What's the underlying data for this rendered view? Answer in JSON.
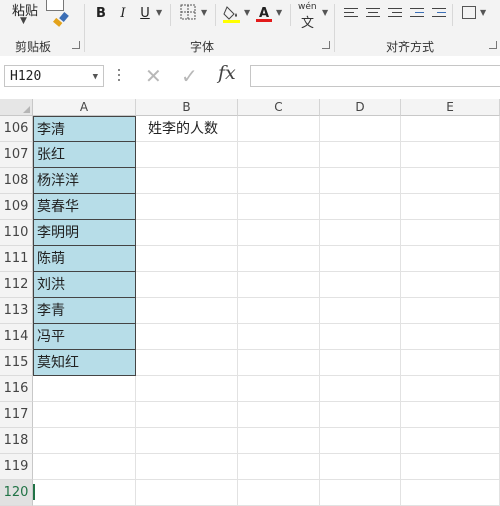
{
  "ribbon": {
    "paste_label": "粘贴",
    "clipboard_label": "剪贴板",
    "font_label": "字体",
    "alignment_label": "对齐方式",
    "bold": "B",
    "italic": "I",
    "underline": "U",
    "font_color_letter": "A",
    "phonetic_top": "wén",
    "phonetic_bottom": "文",
    "accent_red": "#e21a1a",
    "fill_yellow": "#ffff00"
  },
  "formula_bar": {
    "name_box": "H120",
    "fx": "fx",
    "cancel_icon": "cross-icon",
    "enter_icon": "check-icon",
    "value": ""
  },
  "grid": {
    "columns": [
      "A",
      "B",
      "C",
      "D",
      "E"
    ],
    "rows": [
      {
        "num": "106",
        "a": "李清",
        "b": "姓李的人数"
      },
      {
        "num": "107",
        "a": "张红",
        "b": ""
      },
      {
        "num": "108",
        "a": "杨洋洋",
        "b": ""
      },
      {
        "num": "109",
        "a": "莫春华",
        "b": ""
      },
      {
        "num": "110",
        "a": "李明明",
        "b": ""
      },
      {
        "num": "111",
        "a": "陈萌",
        "b": ""
      },
      {
        "num": "112",
        "a": "刘洪",
        "b": ""
      },
      {
        "num": "113",
        "a": "李青",
        "b": ""
      },
      {
        "num": "114",
        "a": "冯平",
        "b": ""
      },
      {
        "num": "115",
        "a": "莫知红",
        "b": ""
      },
      {
        "num": "116",
        "a": "",
        "b": ""
      },
      {
        "num": "117",
        "a": "",
        "b": ""
      },
      {
        "num": "118",
        "a": "",
        "b": ""
      },
      {
        "num": "119",
        "a": "",
        "b": ""
      },
      {
        "num": "120",
        "a": "",
        "b": ""
      }
    ],
    "fill_color": "#b7dde8",
    "select_color": "#217346"
  }
}
